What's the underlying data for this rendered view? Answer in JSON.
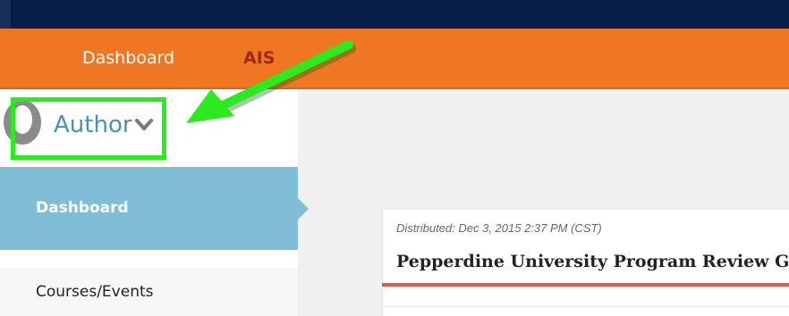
{
  "nav": {
    "items": [
      {
        "label": "Dashboard"
      },
      {
        "label": "AIS"
      }
    ]
  },
  "user_menu": {
    "label": "Author"
  },
  "sidebar": {
    "items": [
      {
        "label": "Dashboard",
        "active": true
      },
      {
        "label": "Courses/Events"
      }
    ]
  },
  "card": {
    "distributed": "Distributed:  Dec 3, 2015 2:37 PM (CST)",
    "title": "Pepperdine University Program Review Gu"
  },
  "colors": {
    "topbar": "#071f4b",
    "navbar": "#ef7622",
    "sidebar_active": "#7fbed6",
    "highlight": "#2bea1e",
    "accent_rule": "#e05a4a",
    "author_text": "#4a90b8"
  }
}
